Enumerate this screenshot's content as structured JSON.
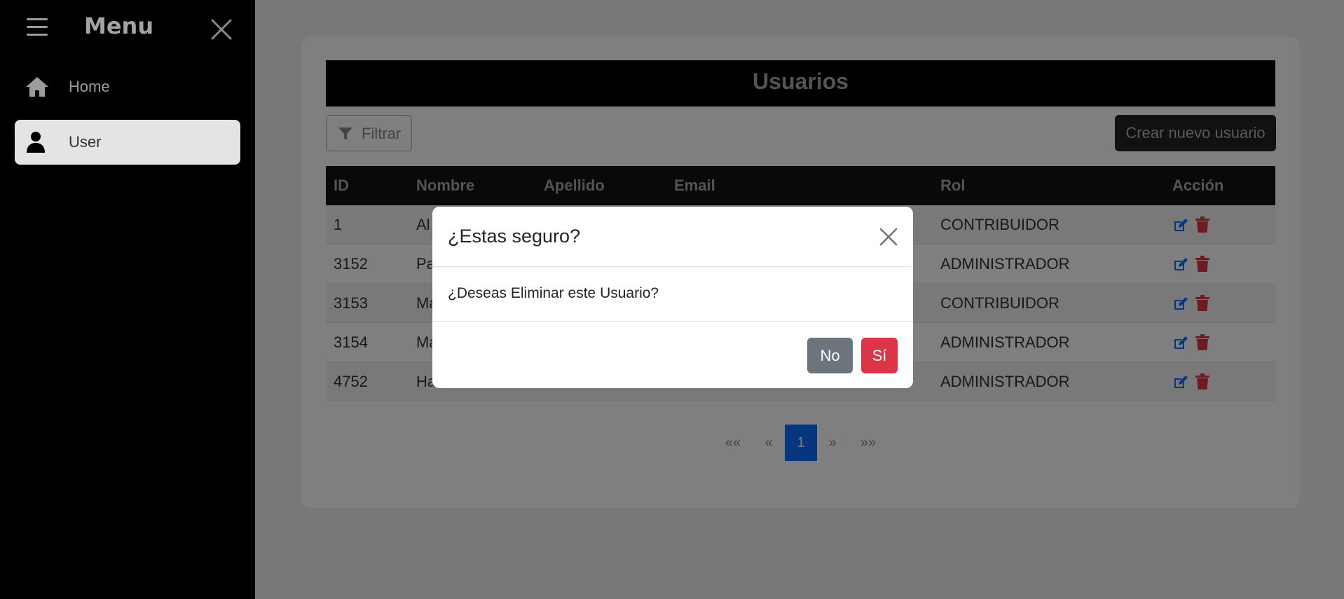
{
  "sidebar": {
    "title": "Menu",
    "items": [
      {
        "label": "Home",
        "icon": "home-icon"
      },
      {
        "label": "User",
        "icon": "user-icon"
      }
    ]
  },
  "main": {
    "title": "Usuarios",
    "filter_label": "Filtrar",
    "create_label": "Crear nuevo usuario",
    "table": {
      "headers": [
        "ID",
        "Nombre",
        "Apellido",
        "Email",
        "Rol",
        "Acción"
      ],
      "rows": [
        {
          "id": "1",
          "nombre": "Al",
          "rol": "CONTRIBUIDOR"
        },
        {
          "id": "3152",
          "nombre": "Pa",
          "rol": "ADMINISTRADOR"
        },
        {
          "id": "3153",
          "nombre": "Ma",
          "rol": "CONTRIBUIDOR"
        },
        {
          "id": "3154",
          "nombre": "Ma",
          "rol": "ADMINISTRADOR"
        },
        {
          "id": "4752",
          "nombre": "Ha",
          "rol": "ADMINISTRADOR"
        }
      ]
    },
    "pagination": {
      "first": "««",
      "prev": "«",
      "current": "1",
      "next": "»",
      "last": "»»"
    }
  },
  "modal": {
    "title": "¿Estas seguro?",
    "body": "¿Deseas Eliminar este Usuario?",
    "no_label": "No",
    "yes_label": "Sí"
  },
  "colors": {
    "primary": "#0d6efd",
    "danger": "#dc3545",
    "secondary": "#6c757d"
  }
}
